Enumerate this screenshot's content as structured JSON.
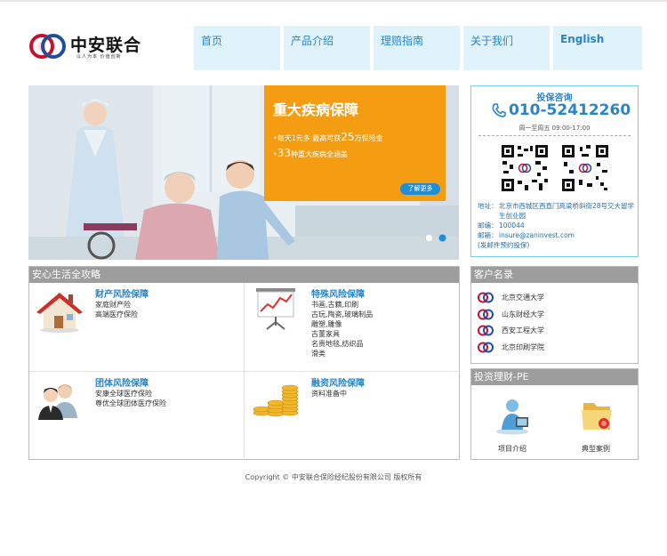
{
  "brand": {
    "name": "中安联合",
    "tagline": "以人为本   价值创新"
  },
  "nav": [
    "首页",
    "产品介绍",
    "理赔指南",
    "关于我们",
    "English"
  ],
  "banner": {
    "title": "重大疾病保障",
    "line1_prefix": "•每天1元多   最高可获",
    "line1_number": "25",
    "line1_suffix": "万保险金",
    "line2_prefix": "•",
    "line2_number": "33",
    "line2_suffix": "种重大疾病全涵盖",
    "more_button": "了解更多"
  },
  "contact": {
    "title": "投保咨询",
    "phone": "010-52412260",
    "hours": "周一至周五  09:00-17:00",
    "address_label": "地址：",
    "address": "北京市西城区西直门高梁桥斜街28号交大留学生创业园",
    "postcode_label": "邮编：",
    "postcode": "100044",
    "email_label": "邮箱：",
    "email": "insure@zaninvest.com",
    "email_note": "(发邮件预约投保)"
  },
  "guide": {
    "title": "安心生活全攻略",
    "categories": [
      {
        "title": "财产风险保障",
        "items": [
          "家庭财产险",
          "高端医疗保险"
        ],
        "icon": "house-icon"
      },
      {
        "title": "特殊风险保障",
        "items": [
          "书画,古籍,印刷",
          "古玩,陶瓷,玻璃制品",
          "雕塑,雕像",
          "古董家具",
          "名贵地毯,纺织品",
          "滑类"
        ],
        "icon": "presentation-chart-icon"
      },
      {
        "title": "团体风险保障",
        "items": [
          "安康全球医疗保险",
          "尊优全球团体医疗保险"
        ],
        "icon": "people-icon"
      },
      {
        "title": "融资风险保障",
        "items": [
          "资料准备中"
        ],
        "icon": "gold-coins-icon"
      }
    ]
  },
  "clients": {
    "title": "客户名录",
    "items": [
      "北京交通大学",
      "山东财经大学",
      "西安工程大学",
      "北京印刷学院"
    ]
  },
  "invest": {
    "title": "投资理财-PE",
    "items": [
      {
        "label": "项目介绍",
        "icon": "project-person-icon"
      },
      {
        "label": "典型案例",
        "icon": "folder-case-icon"
      }
    ]
  },
  "footer": "Copyright © 中安联合保险经纪股份有限公司 版权所有",
  "colors": {
    "accent": "#2a85c7",
    "nav_bg": "#e0f3fb",
    "promo": "#f49d12",
    "panel_head": "#9d9d9d",
    "logo_red": "#c8102e",
    "logo_blue": "#1f4e9c"
  }
}
